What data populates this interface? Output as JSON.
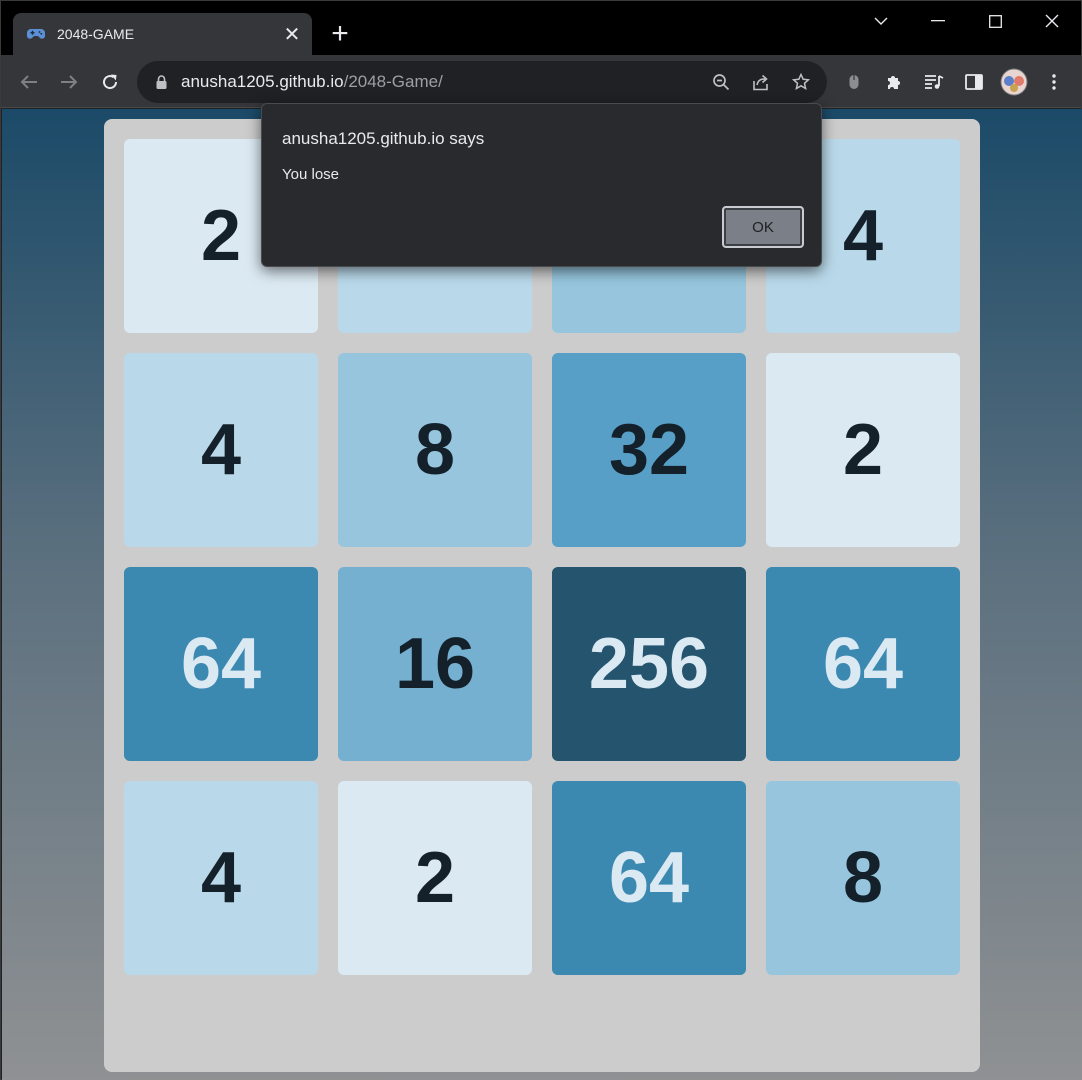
{
  "tab": {
    "title": "2048-GAME",
    "favicon": "game-controller-icon",
    "close": "✕",
    "new_tab": "+"
  },
  "address_bar": {
    "domain": "anusha1205.github.io",
    "path": "/2048-Game/"
  },
  "icons": {
    "back": "arrow-left-icon",
    "forward": "arrow-right-icon",
    "reload": "reload-icon",
    "lock": "lock-icon",
    "zoom": "zoom-out-icon",
    "share": "share-icon",
    "bookmark": "star-icon",
    "extension_1": "mouse-icon",
    "extensions": "puzzle-icon",
    "media": "media-control-icon",
    "side_panel": "side-panel-icon",
    "profile": "avatar",
    "menu": "kebab-menu-icon"
  },
  "game": {
    "colors": {
      "tile_2": "#dbe9f3",
      "tile_4": "#b9d9ea",
      "tile_8": "#96c5dd",
      "tile_16": "#75b0d0",
      "tile_32": "#579fc7",
      "tile_64": "#3b89b1",
      "tile_256": "#24546e",
      "dark_text": "#14212b",
      "light_text": "#dbe9f3",
      "board": "#cccccc"
    },
    "tiles": [
      [
        "2",
        "",
        "",
        "4"
      ],
      [
        "4",
        "8",
        "32",
        "2"
      ],
      [
        "64",
        "16",
        "256",
        "64"
      ],
      [
        "4",
        "2",
        "64",
        "8"
      ]
    ],
    "hidden_tile_colors": [
      "#b9d9ea",
      "#96c5dd"
    ]
  },
  "dialog": {
    "title": "anusha1205.github.io says",
    "message": "You lose",
    "ok_label": "OK"
  }
}
